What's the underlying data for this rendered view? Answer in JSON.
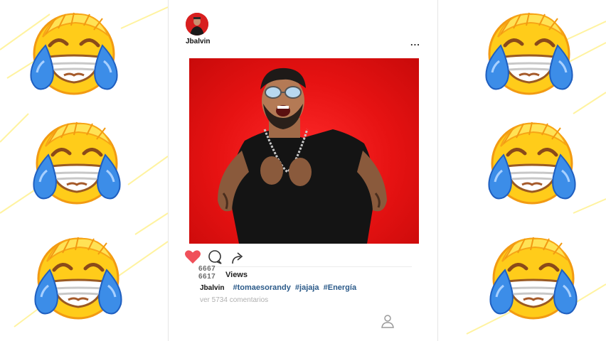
{
  "post": {
    "username": "Jbalvin",
    "more_label": "...",
    "views_numbers": [
      "6667",
      "6617"
    ],
    "views_label": "Views",
    "caption_user": "Jbalvin",
    "hashtags": [
      "#tomaesorandy",
      "#jajaja",
      "#Energía"
    ],
    "comments_link": "ver 5734 comentarios",
    "liked": true
  },
  "colors": {
    "heart": "#f0505a",
    "hashtag": "#2b5a89",
    "photo_background": "#e61212",
    "emoji_face": "#ffcc1a",
    "emoji_tear": "#3c8de8"
  },
  "icons": {
    "like": "heart-icon",
    "comment": "comment-icon",
    "share": "share-icon",
    "more": "more-options-icon",
    "profile": "profile-icon",
    "decor": "laughing-crying-emoji"
  }
}
